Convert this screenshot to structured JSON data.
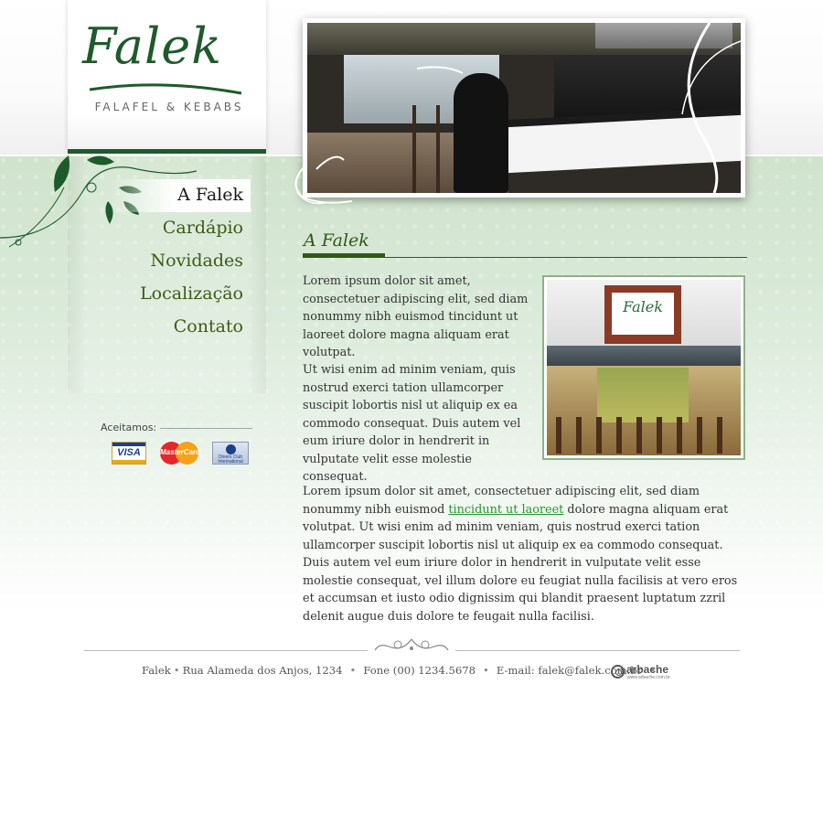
{
  "brand": {
    "name": "Falek",
    "tagline": "FALAFEL & KEBABS",
    "accent_color": "#1d5a2a"
  },
  "nav": {
    "items": [
      {
        "label": "A Falek",
        "active": true
      },
      {
        "label": "Cardápio",
        "active": false
      },
      {
        "label": "Novidades",
        "active": false
      },
      {
        "label": "Localização",
        "active": false
      },
      {
        "label": "Contato",
        "active": false
      }
    ]
  },
  "payments": {
    "label": "Aceitamos:",
    "cards": [
      {
        "name": "visa-card",
        "text": "VISA"
      },
      {
        "name": "mastercard-card",
        "text": "MasterCard"
      },
      {
        "name": "diners-card",
        "text": "Diners Club International"
      }
    ]
  },
  "content": {
    "title": "A Falek",
    "paragraph1": "Lorem ipsum dolor sit amet, consectetuer adipiscing elit, sed diam nonummy nibh euismod tincidunt ut laoreet dolore magna aliquam erat volutpat.",
    "paragraph2": "Ut wisi enim ad minim veniam, quis nostrud exerci tation ullamcorper suscipit lobortis nisl ut aliquip ex ea commodo consequat. Duis autem vel eum iriure dolor in hendrerit in vulputate velit esse molestie consequat.",
    "paragraph3_before": "Lorem ipsum dolor sit amet, consectetuer adipiscing elit, sed diam nonummy nibh euismod ",
    "paragraph3_link": "tincidunt ut laoreet",
    "paragraph3_after": " dolore magna aliquam erat volutpat. Ut wisi enim ad minim veniam, quis nostrud exerci tation ullamcorper suscipit lobortis nisl ut aliquip ex ea commodo consequat. Duis autem vel eum iriure dolor in hendrerit in vulputate velit esse molestie consequat, vel illum dolore eu feugiat nulla facilisis at vero eros et accumsan et iusto odio dignissim qui blandit praesent luptatum zzril delenit augue duis dolore te feugait nulla facilisi.",
    "link_color": "#1f9a2a",
    "storefront_sign": "Falek"
  },
  "footer": {
    "name": "Falek",
    "address": "Rua Alameda dos Anjos, 1234",
    "phone": "Fone (00) 1234.5678",
    "email": "E-mail: falek@falek.com.br",
    "credit": "arbache",
    "credit_url_text": "www.arbache.com.br"
  }
}
